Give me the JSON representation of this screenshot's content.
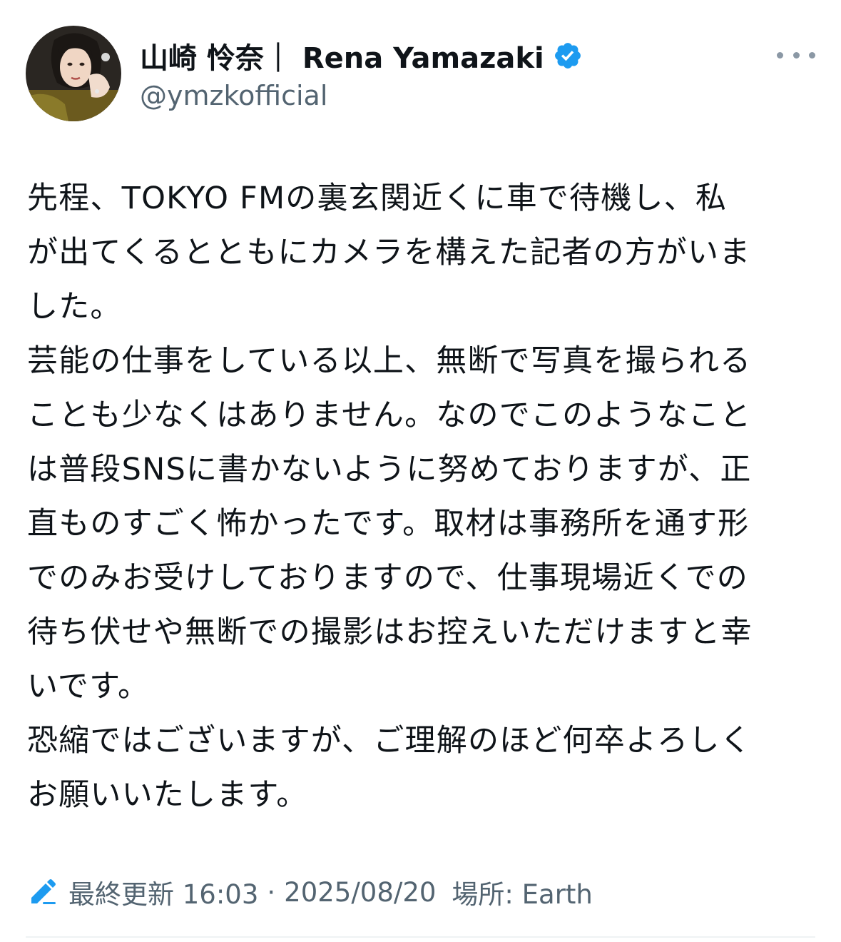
{
  "author": {
    "display_name": "山崎 怜奈｜ Rena Yamazaki",
    "handle": "@ymzkofficial",
    "verified_badge_icon": "verified-badge-icon",
    "badge_color": "#1d9bf0"
  },
  "more_icon": "more-horizontal-icon",
  "post": {
    "lines": [
      "先程、TOKYO FMの裏玄関近くに車で待機し、私",
      "が出てくるとともにカメラを構えた記者の方がいま",
      "した。",
      "芸能の仕事をしている以上、無断で写真を撮られる",
      "ことも少なくはありません。なのでこのようなこと",
      "は普段SNSに書かないように努めておりますが、正",
      "直ものすごく怖かったです。取材は事務所を通す形",
      "でのみお受けしておりますので、仕事現場近くでの",
      "待ち伏せや無断での撮影はお控えいただけますと幸",
      "いです。",
      "恐縮ではございますが、ご理解のほど何卒よろしく",
      "お願いいたします。"
    ]
  },
  "meta": {
    "edit_icon": "edit-pencil-icon",
    "edited_label": "最終更新 16:03",
    "separator": "·",
    "date": "2025/08/20",
    "location": "場所: Earth",
    "accent_color": "#1d9bf0"
  }
}
